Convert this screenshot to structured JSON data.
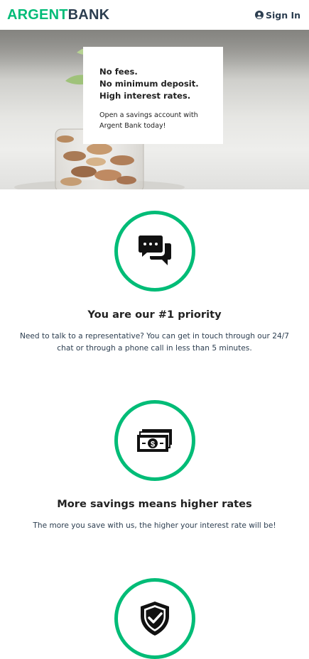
{
  "nav": {
    "logo_part1": "ARGENT",
    "logo_part2": "BANK",
    "signin_label": "Sign In",
    "signin_icon": "user-circle-icon"
  },
  "hero": {
    "subtitles": [
      "No fees.",
      "No minimum deposit.",
      "High interest rates."
    ],
    "text": "Open a savings account with Argent Bank today!"
  },
  "features": [
    {
      "icon": "chat-icon",
      "title": "You are our #1 priority",
      "text": "Need to talk to a representative? You can get in touch through our 24/7 chat or through a phone call in less than 5 minutes."
    },
    {
      "icon": "money-icon",
      "title": "More savings means higher rates",
      "text": "The more you save with us, the higher your interest rate will be!"
    },
    {
      "icon": "security-shield-icon",
      "title": "",
      "text": ""
    }
  ],
  "colors": {
    "accent": "#00bc77",
    "text": "#2c3e50"
  }
}
